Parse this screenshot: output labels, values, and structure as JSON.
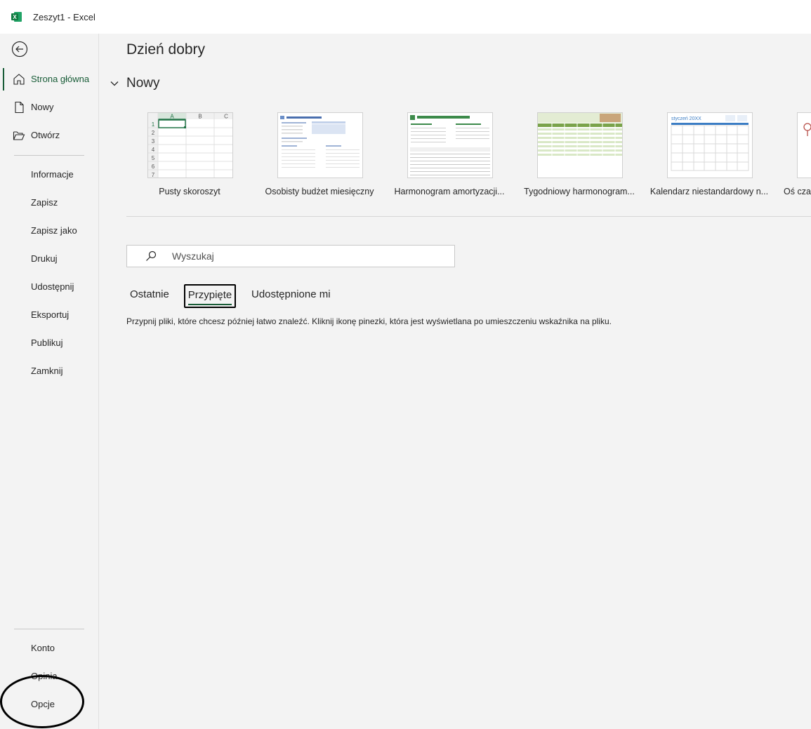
{
  "window": {
    "title": "Zeszyt1  -  Excel",
    "app_icon": "excel-logo"
  },
  "sidebar": {
    "back_icon": "back-arrow-icon",
    "items_top": [
      {
        "label": "Strona główna",
        "icon": "home-icon",
        "active": true
      },
      {
        "label": "Nowy",
        "icon": "new-file-icon"
      },
      {
        "label": "Otwórz",
        "icon": "folder-open-icon"
      }
    ],
    "items_mid": [
      {
        "label": "Informacje"
      },
      {
        "label": "Zapisz"
      },
      {
        "label": "Zapisz jako"
      },
      {
        "label": "Drukuj"
      },
      {
        "label": "Udostępnij"
      },
      {
        "label": "Eksportuj"
      },
      {
        "label": "Publikuj"
      },
      {
        "label": "Zamknij"
      }
    ],
    "items_bottom": [
      {
        "label": "Konto"
      },
      {
        "label": "Opinia"
      },
      {
        "label": "Opcje"
      }
    ]
  },
  "main": {
    "greeting": "Dzień dobry",
    "new_section": {
      "label": "Nowy"
    },
    "templates": [
      {
        "name": "Pusty skoroszyt"
      },
      {
        "name": "Osobisty budżet miesięczny"
      },
      {
        "name": "Harmonogram amortyzacji..."
      },
      {
        "name": "Tygodniowy harmonogram..."
      },
      {
        "name": "Kalendarz niestandardowy n..."
      },
      {
        "name": "Oś czasu"
      }
    ],
    "search": {
      "placeholder": "Wyszukaj"
    },
    "tabs": [
      {
        "label": "Ostatnie"
      },
      {
        "label": "Przypięte",
        "selected": true
      },
      {
        "label": "Udostępnione mi"
      }
    ],
    "hint": "Przypnij pliki, które chcesz później łatwo znaleźć. Kliknij ikonę pinezki, która jest wyświetlana po umieszczeniu wskaźnika na pliku."
  },
  "colors": {
    "accent": "#185c37",
    "background": "#f3f3f3"
  }
}
